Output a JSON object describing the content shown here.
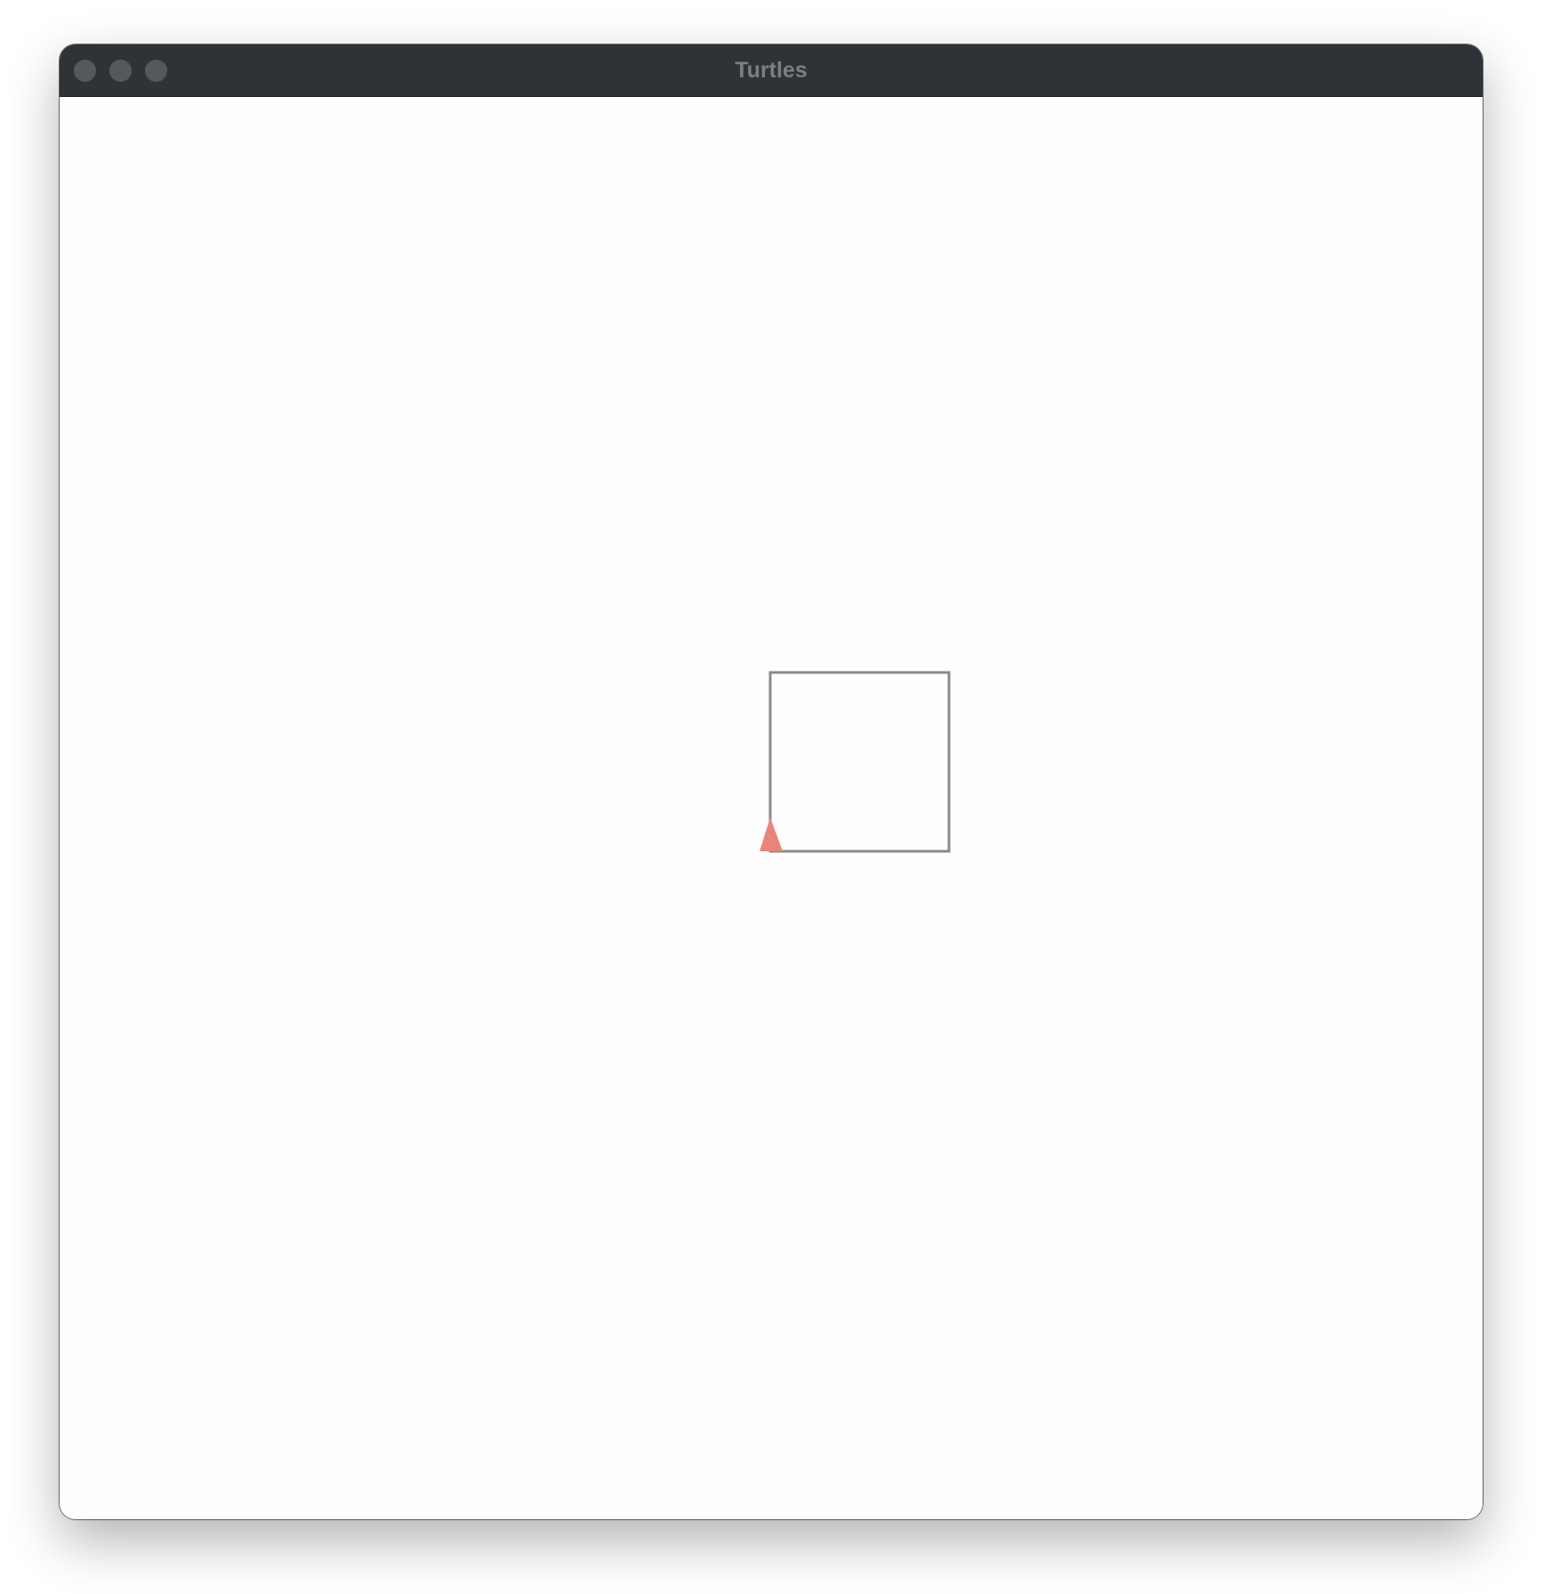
{
  "window": {
    "title": "Turtles"
  },
  "titlebar": {
    "buttons": [
      {
        "name": "close",
        "color": "#55585d"
      },
      {
        "name": "minimize",
        "color": "#55585d"
      },
      {
        "name": "zoom",
        "color": "#55585d"
      }
    ]
  },
  "canvas": {
    "background": "#fefefe",
    "path": {
      "color": "#8a8a8a",
      "shape": "square"
    },
    "turtle": {
      "color": "#e8857a",
      "heading": "up"
    }
  }
}
